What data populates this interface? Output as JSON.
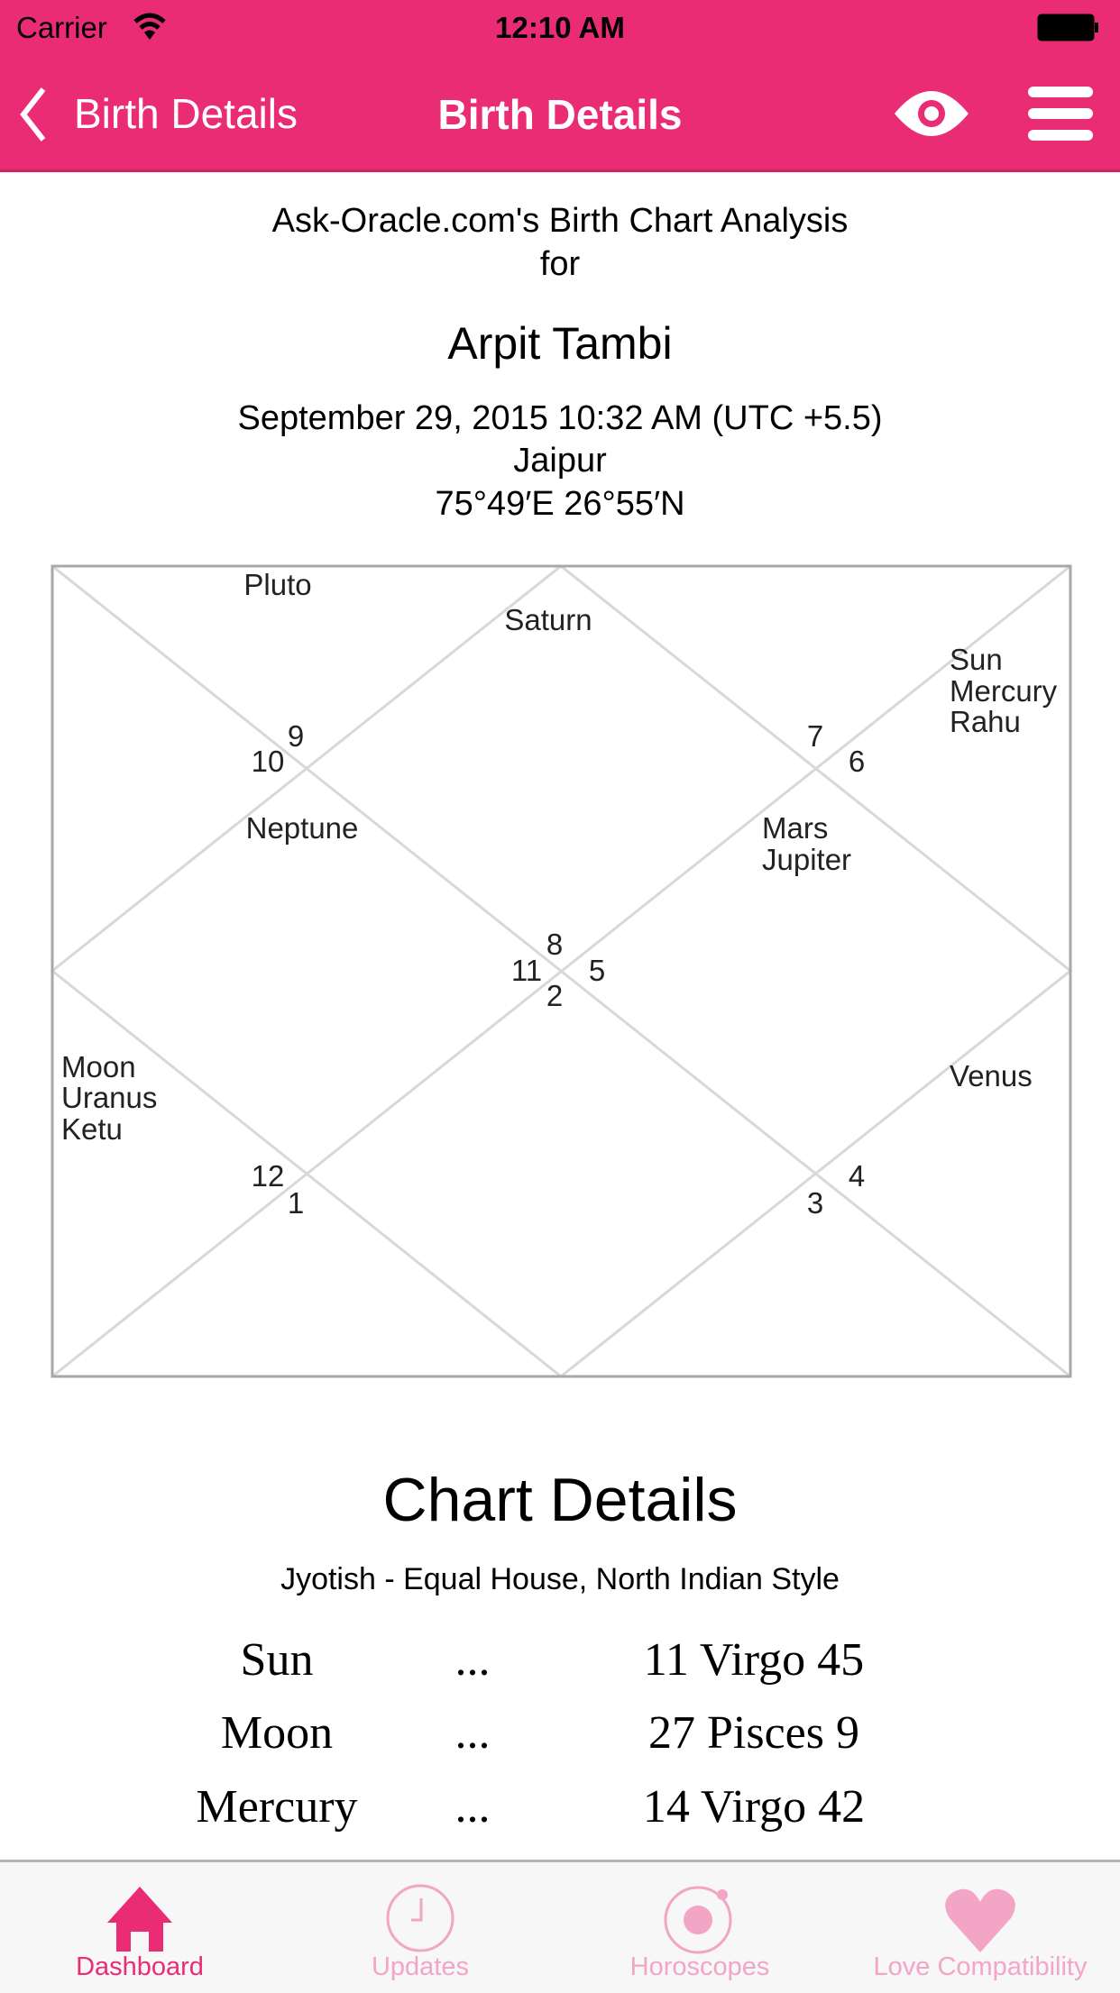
{
  "status_bar": {
    "carrier": "Carrier",
    "time": "12:10 AM"
  },
  "nav": {
    "back_label": "Birth Details",
    "title": "Birth Details",
    "eye_icon": "eye-icon",
    "menu_icon": "hamburger-menu-icon"
  },
  "header": {
    "line1": "Ask-Oracle.com's Birth Chart Analysis",
    "line2": "for",
    "name": "Arpit Tambi",
    "datetime": "September 29, 2015 10:32 AM (UTC +5.5)",
    "place": "Jaipur",
    "coords": "75°49′E 26°55′N"
  },
  "chart": {
    "houses": {
      "h1": "1",
      "h2": "2",
      "h3": "3",
      "h4": "4",
      "h5": "5",
      "h6": "6",
      "h7": "7",
      "h8": "8",
      "h9": "9",
      "h10": "10",
      "h11": "11",
      "h12": "12"
    },
    "planets": {
      "pluto": "Pluto",
      "saturn": "Saturn",
      "sun": "Sun",
      "mercury": "Mercury",
      "rahu": "Rahu",
      "neptune": "Neptune",
      "mars": "Mars",
      "jupiter": "Jupiter",
      "moon": "Moon",
      "uranus": "Uranus",
      "ketu": "Ketu",
      "venus": "Venus"
    }
  },
  "details": {
    "title": "Chart Details",
    "subtitle": "Jyotish - Equal House, North Indian Style",
    "rows": [
      {
        "planet": "Sun",
        "sep": "...",
        "position": "11 Virgo 45"
      },
      {
        "planet": "Moon",
        "sep": "...",
        "position": "27 Pisces 9"
      },
      {
        "planet": "Mercury",
        "sep": "...",
        "position": "14 Virgo 42"
      }
    ]
  },
  "tabs": [
    {
      "label": "Dashboard",
      "icon": "home-icon",
      "active": true
    },
    {
      "label": "Updates",
      "icon": "clock-icon",
      "active": false
    },
    {
      "label": "Horoscopes",
      "icon": "orbit-icon",
      "active": false
    },
    {
      "label": "Love Compatibility",
      "icon": "heart-icon",
      "active": false
    }
  ],
  "colors": {
    "brand": "#e92c73",
    "tab_inactive": "#f2a5c4",
    "tab_bg": "#f7f7f7"
  }
}
